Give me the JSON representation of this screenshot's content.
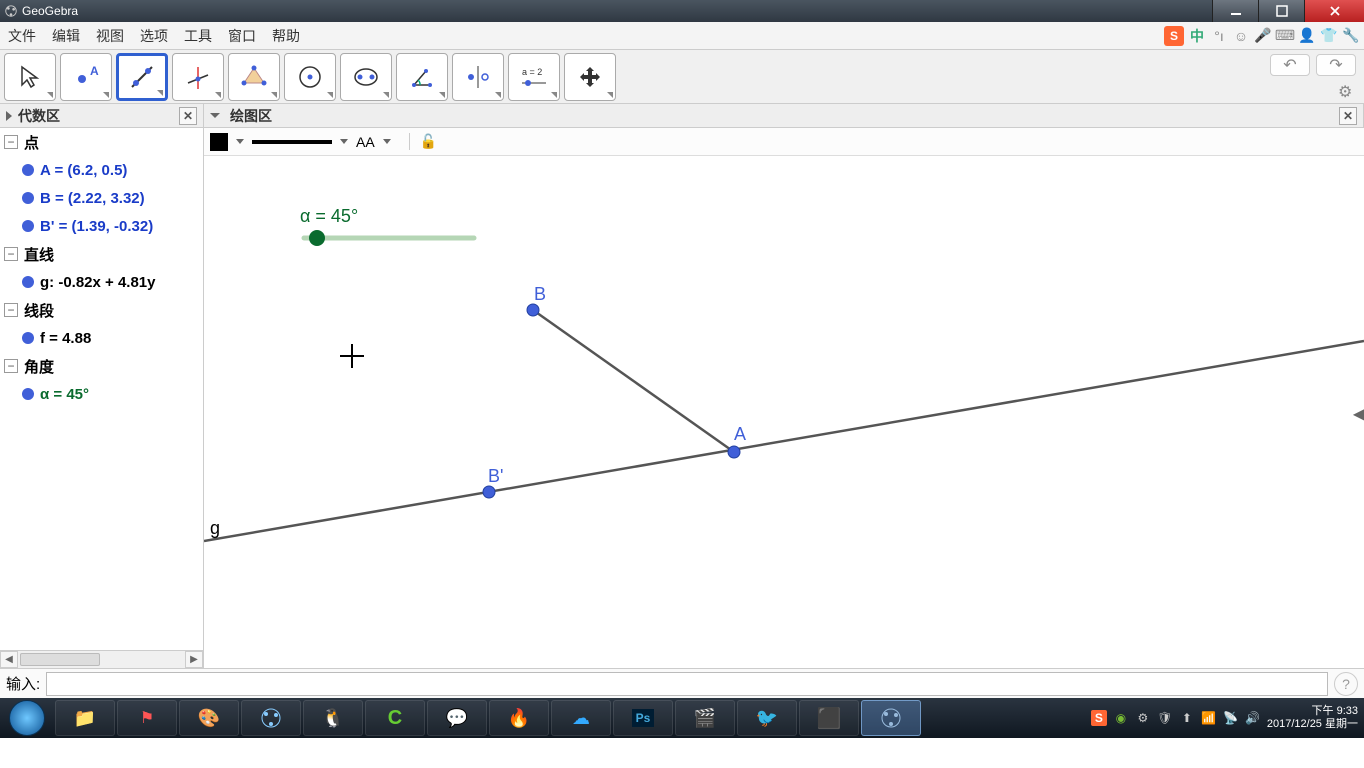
{
  "titlebar": {
    "app_name": "GeoGebra"
  },
  "menu": {
    "items": [
      "文件",
      "编辑",
      "视图",
      "选项",
      "工具",
      "窗口",
      "帮助"
    ],
    "ime_label": "中"
  },
  "panels": {
    "algebra_title": "代数区",
    "graphics_title": "绘图区"
  },
  "algebra": {
    "cat_point": "点",
    "p_A": "A = (6.2, 0.5)",
    "p_B": "B = (2.22, 3.32)",
    "p_Bp": "B' = (1.39, -0.32)",
    "cat_line": "直线",
    "g": "g: -0.82x + 4.81y",
    "cat_segment": "线段",
    "f": "f = 4.88",
    "cat_angle": "角度",
    "alpha": "α = 45°"
  },
  "stylebar": {
    "font_label": "AA"
  },
  "canvas": {
    "slider_label": "α = 45°",
    "label_B": "B",
    "label_A": "A",
    "label_Bp": "B'",
    "label_g": "g"
  },
  "input": {
    "label": "输入:",
    "value": ""
  },
  "taskbar": {
    "time": "下午 9:33",
    "date": "2017/12/25 星期一"
  },
  "chart_data": {
    "type": "geometry",
    "points": {
      "A": [
        6.2,
        0.5
      ],
      "B": [
        2.22,
        3.32
      ],
      "B'": [
        1.39,
        -0.32
      ]
    },
    "line_g": {
      "equation": "-0.82x + 4.81y",
      "through": "A"
    },
    "segment_f": {
      "from": "A",
      "to": "B",
      "length": 4.88
    },
    "angle_alpha_deg": 45,
    "slider": {
      "name": "α",
      "value": 45,
      "unit": "°"
    }
  }
}
